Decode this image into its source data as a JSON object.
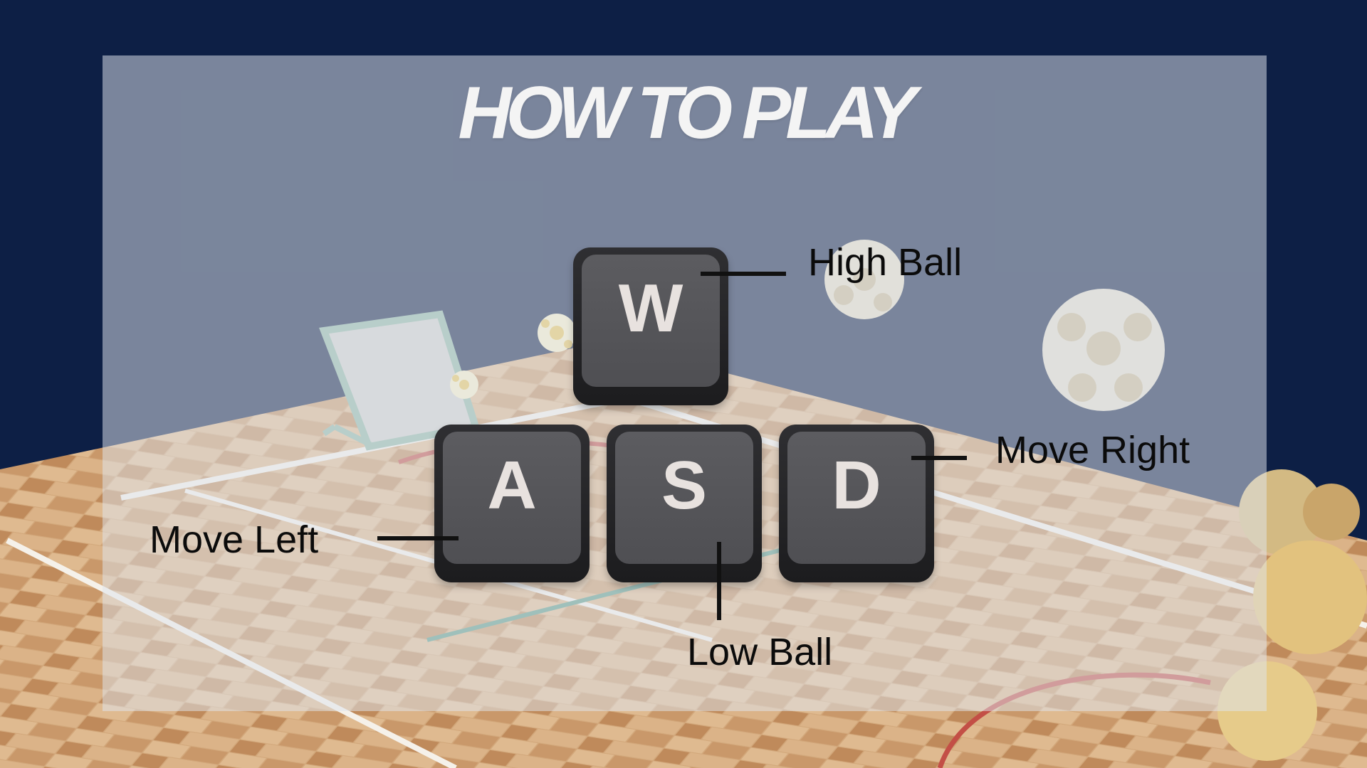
{
  "screen": {
    "title": "HOW TO PLAY"
  },
  "controls": [
    {
      "key": "W",
      "action": "High Ball"
    },
    {
      "key": "A",
      "action": "Move Left"
    },
    {
      "key": "S",
      "action": "Low Ball"
    },
    {
      "key": "D",
      "action": "Move Right"
    }
  ],
  "colors": {
    "background": "#0d1f45",
    "panel_overlay": "#dee4ec",
    "key_face": "#58585c",
    "key_glyph": "#e8e2df",
    "label_text": "#0b0b0b",
    "title_text": "#f4f4f4"
  },
  "icons": {
    "background_scene": "wooden-court-with-rebounder-and-balls"
  }
}
